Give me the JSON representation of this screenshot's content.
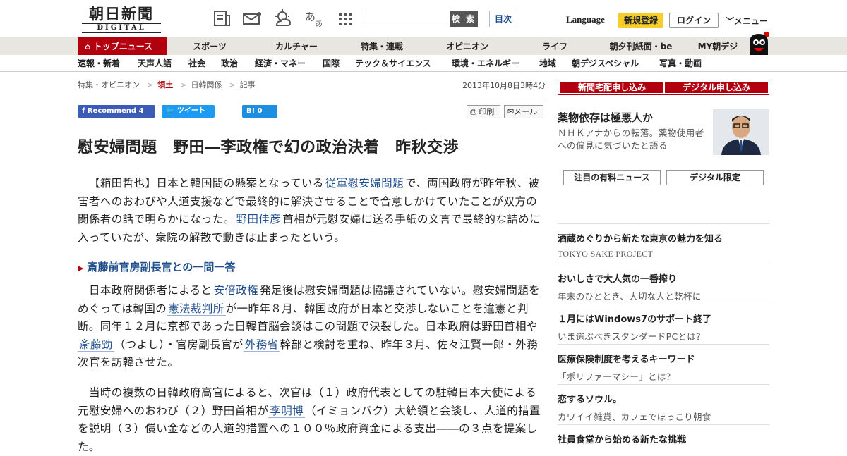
{
  "header": {
    "logo_jp": "朝日新聞",
    "logo_en": "DIGITAL",
    "search_button": "検 索",
    "index_button": "目次",
    "language": "Language",
    "signup": "新規登録",
    "login": "ログイン",
    "menu": "メニュー"
  },
  "nav1": {
    "top": "トップニュース",
    "items": [
      "スポーツ",
      "カルチャー",
      "特集・連載",
      "オピニオン",
      "ライフ",
      "朝夕刊紙面・be",
      "MY朝デジ"
    ]
  },
  "nav2": {
    "items": [
      "速報・新着",
      "天声人語",
      "社会",
      "政治",
      "経済・マネー",
      "国際",
      "テック＆サイエンス",
      "環境・エネルギー",
      "地域",
      "朝デジスペシャル",
      "写真・動画"
    ]
  },
  "breadcrumb": [
    "特集・オピニオン",
    "領土",
    "日韓関係",
    "記事"
  ],
  "date": "2013年10月8日3時4分",
  "share": {
    "facebook": "Recommend",
    "facebook_count": "4",
    "twitter": "ツイート",
    "hatena": "B!",
    "hatena_count": "0",
    "print": "印刷",
    "mail": "メール"
  },
  "article": {
    "headline": "慰安婦問題　野田―李政権で幻の政治決着　昨秋交渉",
    "p1": {
      "a": "【箱田哲也】日本と韓国間の懸案となっている",
      "l1": "従軍慰安婦問題",
      "b": "で、両国政府が昨年秋、被害者へのおわびや人道支援などで最終的に解決させることで合意しかけていたことが双方の関係者の話で明らかになった。",
      "l2": "野田佳彦",
      "c": "首相が元慰安婦に送る手紙の文言で最終的な詰めに入っていたが、衆院の解散で動きは止まったという。"
    },
    "subhead": "斎藤前官房副長官との一問一答",
    "p2": {
      "a": "日本政府関係者によると",
      "l1": "安倍政権",
      "b": "発足後は慰安婦問題は協議されていない。慰安婦問題をめぐっては韓国の",
      "l2": "憲法裁判所",
      "c": "が一昨年８月、韓国政府が日本と交渉しないことを違憲と判断。同年１２月に京都であった日韓首脳会談はこの問題で決裂した。日本政府は野田首相や",
      "l3": "斎藤勁",
      "d": "（つよし）・官房副長官が",
      "l4": "外務省",
      "e": "幹部と検討を重ね、昨年３月、佐々江賢一郎・外務次官を訪韓させた。"
    },
    "p3": {
      "a": "当時の複数の日韓政府高官によると、次官は（１）政府代表としての駐韓日本大使による元慰安婦へのおわび（２）野田首相が",
      "l1": "李明博",
      "b": "（イミョンバク）大統領と会談し、人道的措置を説明（３）償い金などの人道的措置への１００％政府資金による支出――の３点を提案した。"
    }
  },
  "sidebar": {
    "apply_paper": "新聞宅配申し込み",
    "apply_digital": "デジタル申し込み",
    "promo_title": "薬物依存は極悪人か",
    "promo_desc": "ＮＨＫアナからの転落。薬物使用者への偏見に気づいたと語る",
    "tab1": "注目の有料ニュース",
    "tab2": "デジタル限定",
    "items": [
      {
        "title": "酒蔵めぐりから新たな東京の魅力を知る",
        "sub": "TOKYO SAKE PROJECT"
      },
      {
        "title": "おいしさで大人気の一番搾り",
        "sub": "年末のひととき、大切な人と乾杯に"
      },
      {
        "title": "１月にはWindows7のサポート終了",
        "sub": "いま選ぶべきスタンダードPCとは？"
      },
      {
        "title": "医療保険制度を考えるキーワード",
        "sub": "「ポリファーマシー」とは？"
      },
      {
        "title": "恋するソウル。",
        "sub": "カワイイ雑貨、カフェでほっこり朝食"
      },
      {
        "title": "社員食堂から始める新たな挑戦",
        "sub": ""
      }
    ]
  }
}
